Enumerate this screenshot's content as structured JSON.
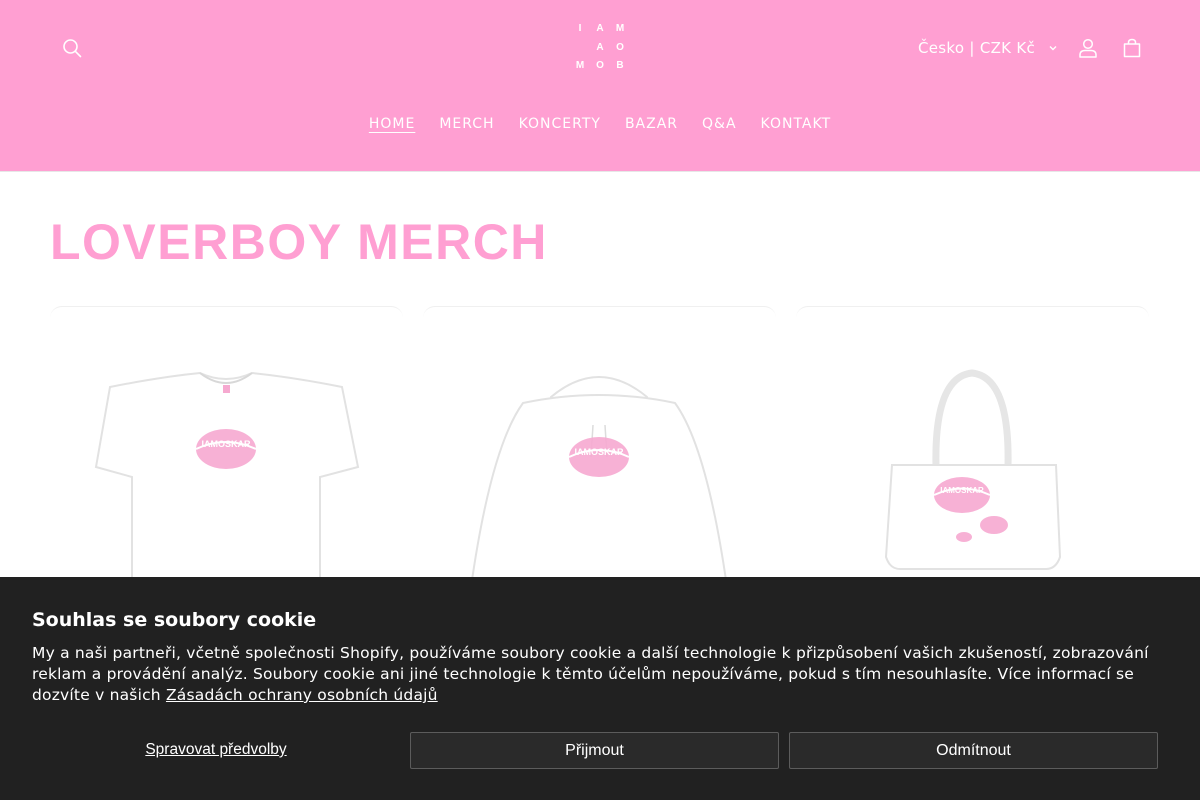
{
  "header": {
    "logo_letters": [
      "I",
      "A",
      "M",
      "",
      "A",
      "O",
      "M",
      "O",
      "B"
    ],
    "locale_label": "Česko | CZK Kč",
    "nav": [
      {
        "label": "HOME",
        "active": true
      },
      {
        "label": "MERCH",
        "active": false
      },
      {
        "label": "KONCERTY",
        "active": false
      },
      {
        "label": "BAZAR",
        "active": false
      },
      {
        "label": "Q&A",
        "active": false
      },
      {
        "label": "KONTAKT",
        "active": false
      }
    ],
    "icons": {
      "search": "search-icon",
      "account": "user-icon",
      "cart": "bag-icon",
      "locale": "chevron-down-icon"
    }
  },
  "main": {
    "title": "LOVERBOY MERCH",
    "products": [
      {
        "kind": "t-shirt",
        "print_text": "IAMOSKAR"
      },
      {
        "kind": "hoodie",
        "print_text": "IAMOSKAR"
      },
      {
        "kind": "tote-bag",
        "print_text": "IAMOSKAR"
      }
    ]
  },
  "cookie": {
    "title": "Souhlas se soubory cookie",
    "text": "My a naši partneři, včetně společnosti Shopify, používáme soubory cookie a další technologie k přizpůsobení vašich zkušeností, zobrazování reklam a provádění analýz. Soubory cookie ani jiné technologie k těmto účelům nepoužíváme, pokud s tím nesouhlasíte. Více informací se dozvíte v našich ",
    "privacy_link": "Zásadách ochrany osobních údajů",
    "manage_label": "Spravovat předvolby",
    "accept_label": "Přijmout",
    "decline_label": "Odmítnout"
  },
  "colors": {
    "brand_pink": "#ff9fd2",
    "print_pink": "#f6a9d0",
    "cookie_bg": "#212121"
  }
}
